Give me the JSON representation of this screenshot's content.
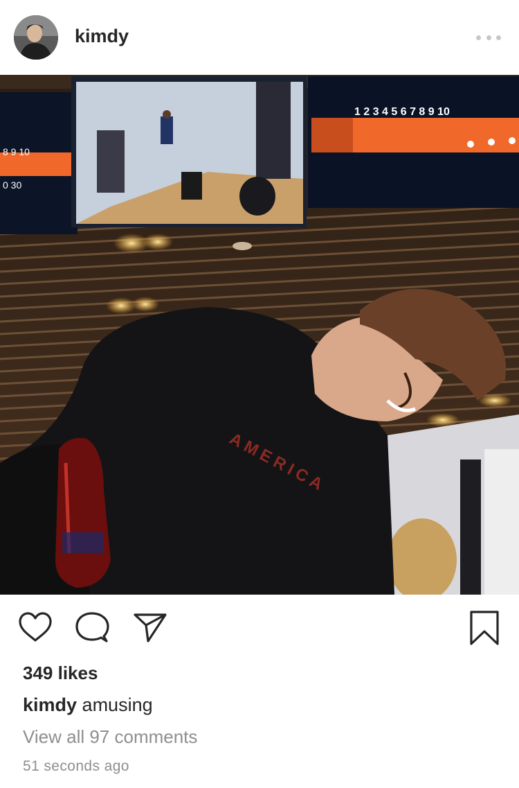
{
  "post": {
    "username": "kimdy",
    "likes": "349 likes",
    "caption_user": "kimdy",
    "caption_text": " amusing",
    "view_comments": "View all 97 comments",
    "timestamp": "51 seconds ago"
  },
  "photo": {
    "scoreboard_left": [
      "8 9 10",
      "0 30"
    ],
    "scoreboard_right": "1 2 3 4 5 6 7 8 9 10",
    "shirt_text": "AMERICA"
  },
  "icons": {
    "more": "more-options-icon",
    "like": "heart-icon",
    "comment": "comment-bubble-icon",
    "share": "paper-plane-icon",
    "save": "bookmark-icon"
  },
  "colors": {
    "text": "#262626",
    "secondary": "#8e8e8e",
    "more_dots": "#c7c7c7",
    "scoreboard_orange": "#f0692a"
  }
}
